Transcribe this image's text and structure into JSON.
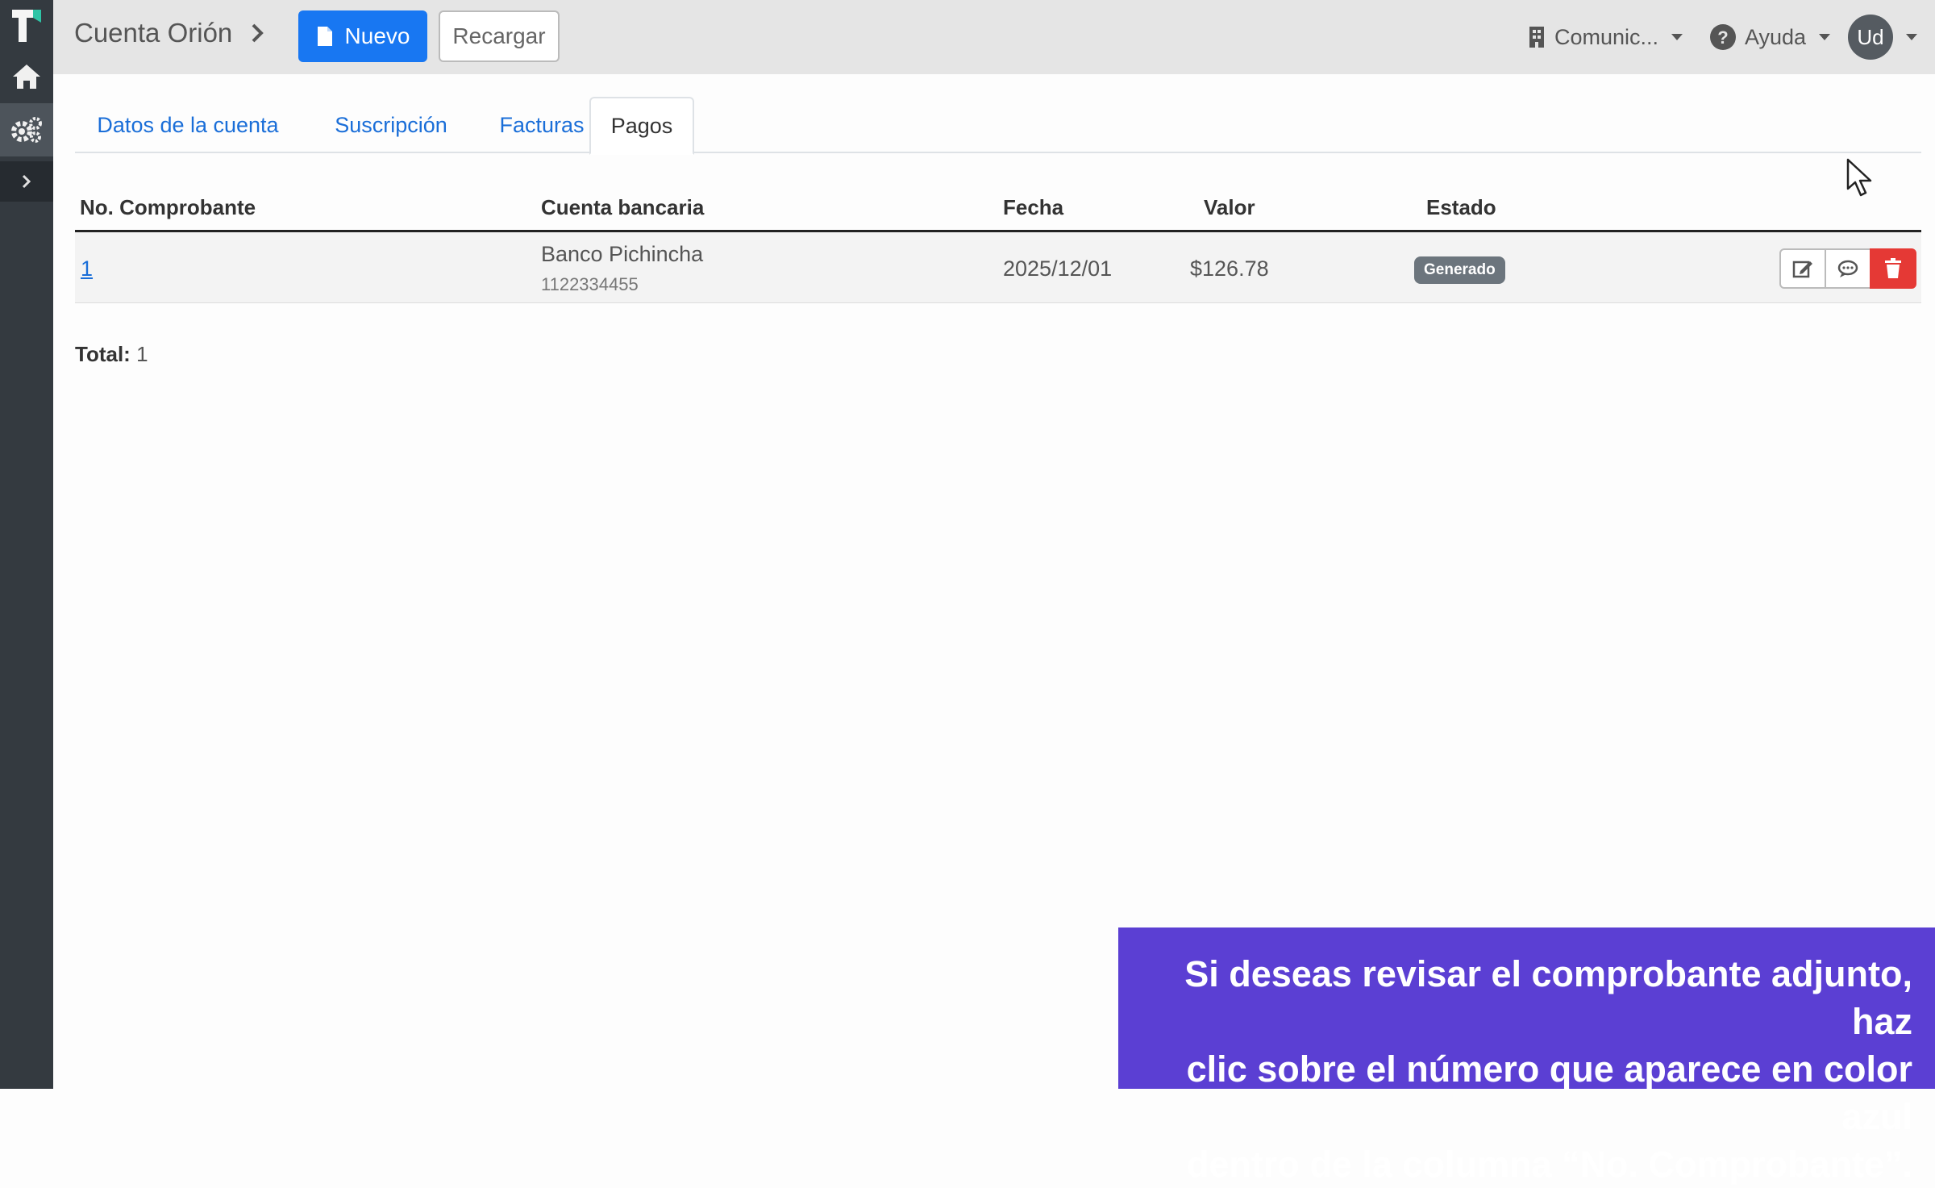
{
  "header": {
    "breadcrumb": "Cuenta Orión",
    "new_label": "Nuevo",
    "reload_label": "Recargar",
    "company_label": "Comunic...",
    "help_label": "Ayuda",
    "avatar_initials": "Ud"
  },
  "tabs": [
    {
      "label": "Datos de la cuenta"
    },
    {
      "label": "Suscripción"
    },
    {
      "label": "Facturas"
    },
    {
      "label": "Pagos",
      "active": true
    }
  ],
  "table": {
    "columns": [
      "No. Comprobante",
      "Cuenta bancaria",
      "Fecha",
      "Valor",
      "Estado"
    ],
    "rows": [
      {
        "comprobante": "1",
        "banco": "Banco Pichincha",
        "cuenta": "1122334455",
        "fecha": "2025/12/01",
        "valor": "$126.78",
        "estado": "Generado"
      }
    ]
  },
  "total": {
    "label": "Total:",
    "value": "1"
  },
  "caption": {
    "line1": "Si deseas revisar el comprobante adjunto, haz",
    "line2": "clic sobre el número que aparece en color azul",
    "line3": "dentro de la columna “No. Comprobante”."
  },
  "colors": {
    "primary": "#1877f2",
    "sidebar": "#343a40",
    "danger": "#e53935",
    "caption_bg": "#5b3fd3",
    "badge": "#6c757d"
  }
}
